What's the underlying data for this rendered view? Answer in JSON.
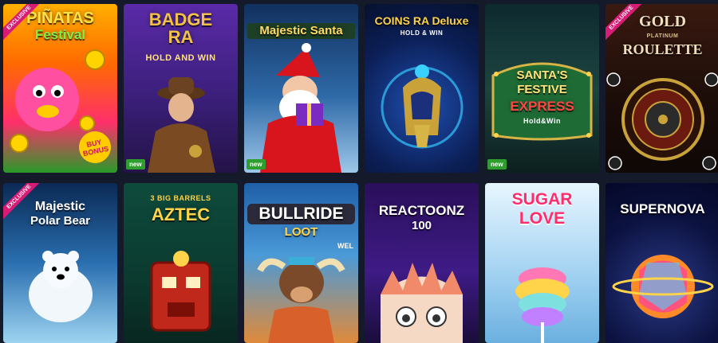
{
  "games": [
    {
      "id": "pinatas",
      "title": "PIÑATAS",
      "title2": "Festival",
      "ribbon": "EXCLUSIVE",
      "extra": "BUY BONUS",
      "colors": [
        "#ff3a7a",
        "#ffcc00"
      ]
    },
    {
      "id": "badge-ra",
      "title": "BADGE",
      "title2": "RA",
      "subtitle": "HOLD AND WIN",
      "badge": "new"
    },
    {
      "id": "majestic-santa",
      "title": "Majestic Santa",
      "badge": "new"
    },
    {
      "id": "coins-ra",
      "title": "COINS RA Deluxe",
      "subtitle": "HOLD & WIN"
    },
    {
      "id": "santas-express",
      "title": "SANTA'S",
      "title2": "FESTIVE",
      "title3": "EXPRESS",
      "subtitle": "Hold&Win",
      "badge": "new"
    },
    {
      "id": "gold-roulette",
      "title": "GOLD",
      "subtitle": "PLATINUM",
      "title2": "ROULETTE",
      "ribbon": "EXCLUSIVE"
    },
    {
      "id": "polar-bear",
      "title": "Majestic",
      "title2": "Polar Bear",
      "ribbon": "EXCLUSIVE"
    },
    {
      "id": "aztec",
      "title": "3 BIG BARRELS",
      "title2": "AZTEC"
    },
    {
      "id": "bullride",
      "title": "BULLRIDE",
      "title2": "LOOT",
      "extra": "WEL"
    },
    {
      "id": "reactoonz",
      "title": "REACTOONZ",
      "title2": "100"
    },
    {
      "id": "sugar-love",
      "title": "SUGAR",
      "title2": "LOVE"
    },
    {
      "id": "supernova",
      "title": "SUPERNOVA"
    }
  ]
}
